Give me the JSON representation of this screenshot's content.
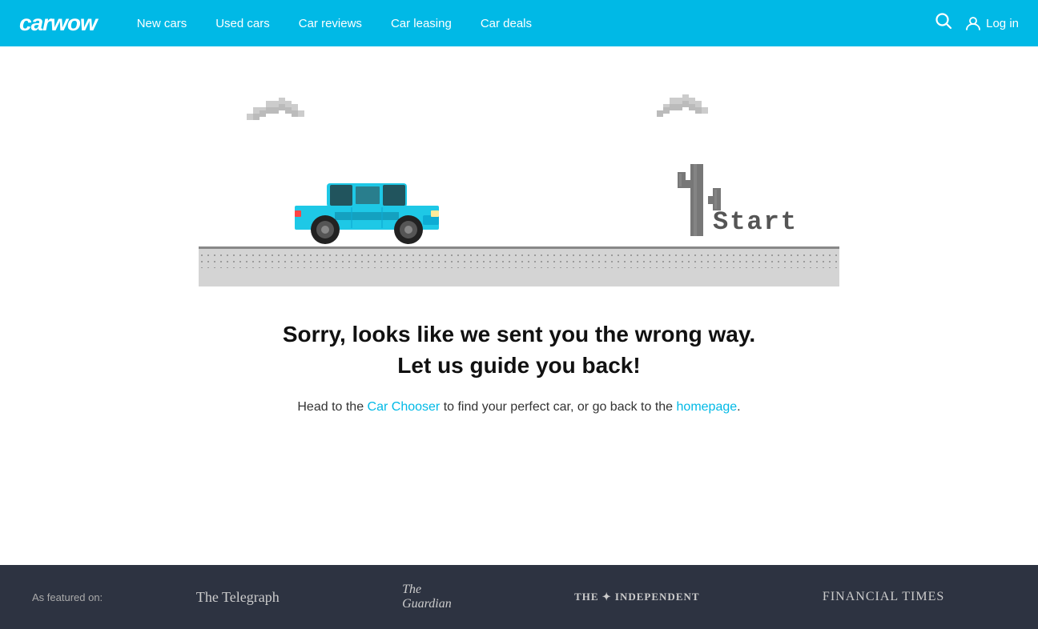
{
  "navbar": {
    "logo": "carwow",
    "links": [
      {
        "label": "New cars",
        "id": "new-cars"
      },
      {
        "label": "Used cars",
        "id": "used-cars"
      },
      {
        "label": "Car reviews",
        "id": "car-reviews"
      },
      {
        "label": "Car leasing",
        "id": "car-leasing"
      },
      {
        "label": "Car deals",
        "id": "car-deals"
      }
    ],
    "login_label": "Log in"
  },
  "main": {
    "heading_line1": "Sorry, looks like we sent you the wrong way.",
    "heading_line2": "Let us guide you back!",
    "subtext_before": "Head to the ",
    "subtext_link1": "Car Chooser",
    "subtext_middle": " to find your perfect car, or go back to the ",
    "subtext_link2": "homepage",
    "subtext_end": ".",
    "game_start_label": "Start"
  },
  "footer": {
    "featured_label": "As featured on:",
    "logos": [
      {
        "name": "The Telegraph",
        "class": "telegraph"
      },
      {
        "name": "The Guardian",
        "class": "guardian"
      },
      {
        "name": "THE INDEPENDENT",
        "class": "independent"
      },
      {
        "name": "FINANCIAL TIMES",
        "class": "ft"
      }
    ]
  },
  "icons": {
    "search": "🔍",
    "user": "👤"
  }
}
